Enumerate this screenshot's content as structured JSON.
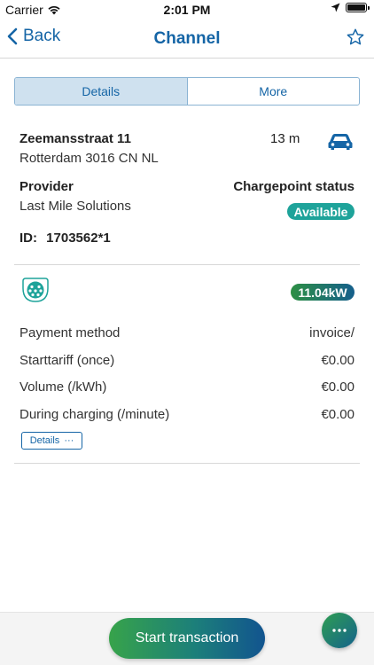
{
  "status_bar": {
    "carrier": "Carrier",
    "time": "2:01 PM"
  },
  "nav": {
    "back_label": "Back",
    "title": "Channel",
    "icons": {
      "back": "chevron-left-icon",
      "favorite": "star-outline-icon"
    }
  },
  "tabs": [
    {
      "label": "Details",
      "active": true
    },
    {
      "label": "More",
      "active": false
    }
  ],
  "location": {
    "street": "Zeemansstraat 11",
    "city": "Rotterdam 3016 CN NL",
    "distance": "13 m",
    "vehicle_icon": "car-icon"
  },
  "provider": {
    "heading": "Provider",
    "name": "Last Mile Solutions",
    "status_heading": "Chargepoint status",
    "status": "Available",
    "status_color": "#1ea39a"
  },
  "id": {
    "label": "ID:",
    "value": "1703562*1"
  },
  "connector": {
    "icon": "type2-connector-icon",
    "power": "11.04kW"
  },
  "tariffs": [
    {
      "label": "Payment method",
      "value": "invoice/"
    },
    {
      "label": "Starttariff (once)",
      "value": "€0.00"
    },
    {
      "label": "Volume (/kWh)",
      "value": "€0.00"
    },
    {
      "label": "During charging (/minute)",
      "value": "€0.00"
    }
  ],
  "details_button": {
    "label": "Details",
    "suffix": "···"
  },
  "actions": {
    "start_label": "Start transaction",
    "more_icon": "more-horizontal-icon"
  },
  "colors": {
    "accent": "#1565a6",
    "green": "#37a34a"
  }
}
